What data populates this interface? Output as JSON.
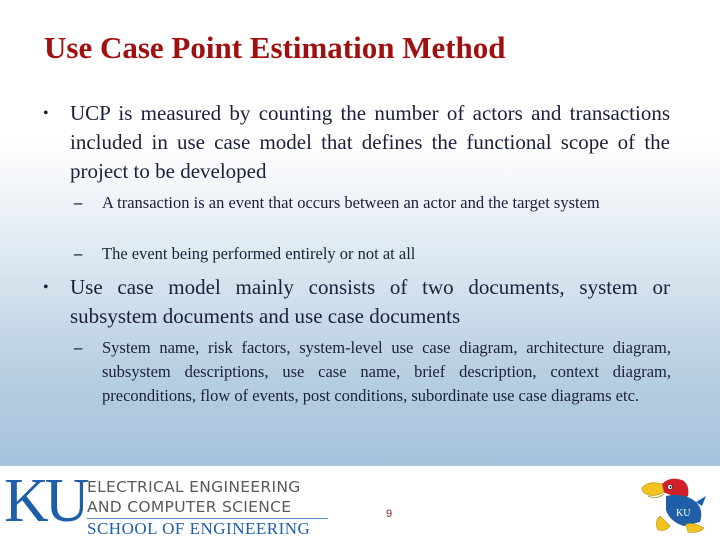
{
  "slide": {
    "title": "Use Case Point Estimation Method",
    "page_number": "9",
    "colors": {
      "title": "#a01010",
      "body_text": "#1b1f3b",
      "ku_blue": "#1f5fa8",
      "page_number": "#8b1a1a"
    }
  },
  "content": {
    "bullets": [
      {
        "text": "UCP is measured by counting the number of actors and transactions included in use case model that defines the functional scope of the project to be developed",
        "subbullets": [
          "A transaction is an event that occurs between an actor and the target system",
          "The event being performed entirely or not at all"
        ]
      },
      {
        "text": "Use case model mainly consists of two documents, system or subsystem documents and use case documents",
        "subbullets": [
          "System name, risk factors, system-level use case diagram, architecture diagram, subsystem descriptions, use case name, brief description, context diagram, preconditions, flow of events, post conditions, subordinate use case diagrams etc."
        ]
      }
    ],
    "bullet_glyph": "•",
    "dash_glyph": "–"
  },
  "footer": {
    "logo_letters": "KU",
    "dept_line1": "ELECTRICAL ENGINEERING",
    "dept_line2": "AND COMPUTER SCIENCE",
    "school": "SCHOOL OF ENGINEERING",
    "mascot_icon": "jayhawk-mascot-icon",
    "mascot_label": "KU"
  }
}
